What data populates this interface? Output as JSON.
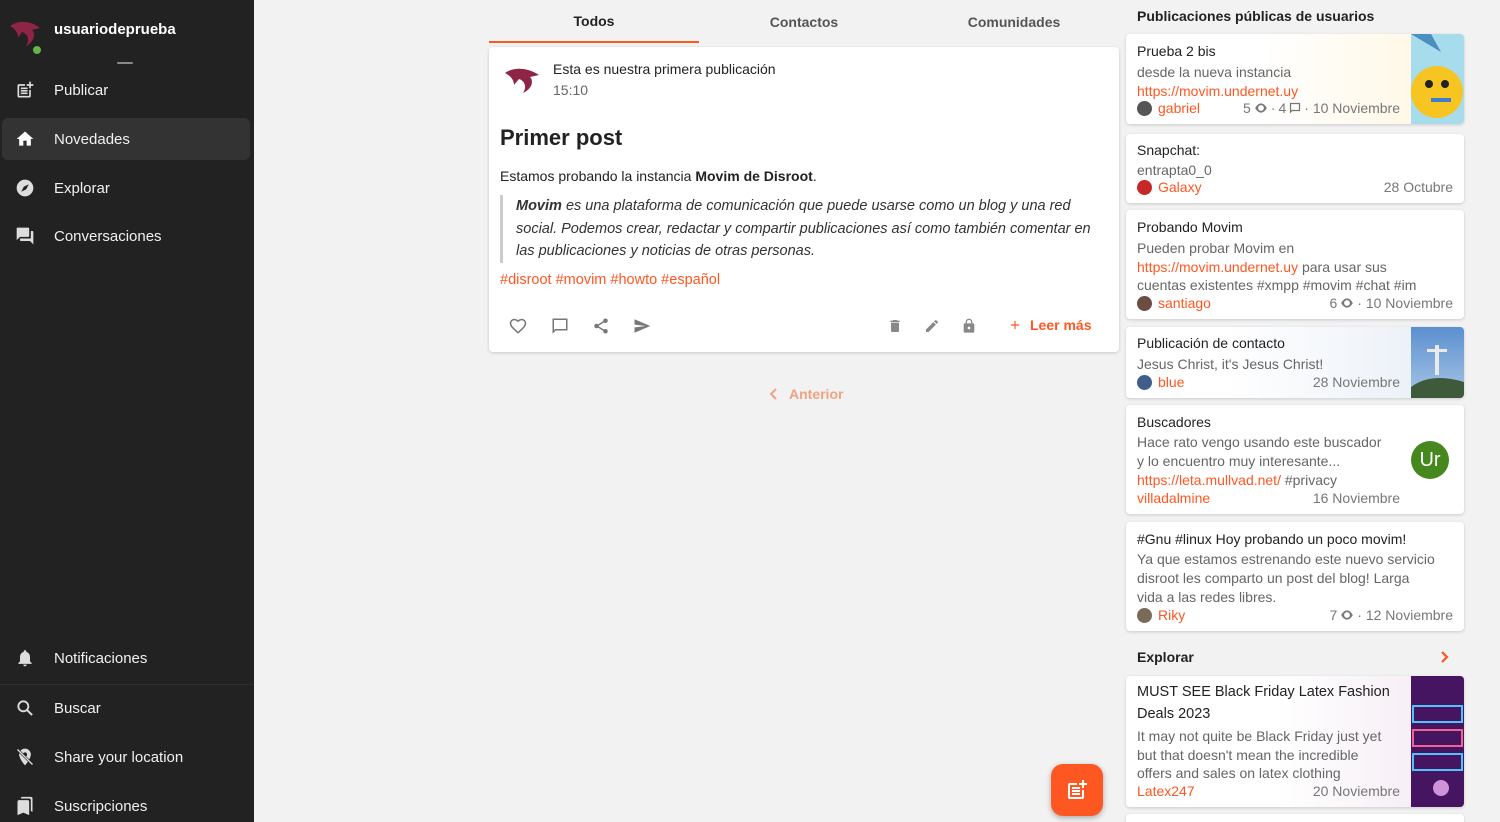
{
  "sidebar": {
    "username": "usuariodeprueba",
    "nav_top": [
      {
        "label": "Publicar",
        "icon": "post-add-icon"
      },
      {
        "label": "Novedades",
        "icon": "home-icon"
      },
      {
        "label": "Explorar",
        "icon": "compass-icon"
      },
      {
        "label": "Conversaciones",
        "icon": "chat-icon"
      }
    ],
    "nav_bottom": [
      {
        "label": "Notificaciones",
        "icon": "bell-icon"
      },
      {
        "label": "Buscar",
        "icon": "search-icon"
      },
      {
        "label": "Share your location",
        "icon": "location-off-icon"
      },
      {
        "label": "Suscripciones",
        "icon": "bookmarks-icon"
      }
    ]
  },
  "tabs": [
    "Todos",
    "Contactos",
    "Comunidades"
  ],
  "post": {
    "header_title": "Esta es nuestra primera publicación",
    "time": "15:10",
    "title": "Primer post",
    "intro_text": "Estamos probando la instancia ",
    "intro_bold": "Movim de Disroot",
    "intro_end": ".",
    "quote_bold": "Movim",
    "quote_text": " es una plataforma de comunicación que puede usarse como un blog y una red social. Podemos crear, redactar y compartir publicaciones así como también comentar en las publicaciones y noticias de otras personas.",
    "tags": "#disroot #movim #howto #español",
    "read_more": "Leer más"
  },
  "pagination": {
    "previous": "Anterior"
  },
  "right": {
    "public_heading": "Publicaciones públicas de usuarios",
    "cards": [
      {
        "title": "Prueba 2 bis",
        "line1": "desde la nueva instancia",
        "link": "https://movim.undernet.uy",
        "author": "gabriel",
        "views": "5",
        "comments": "4",
        "date": "· 10 Noviembre"
      },
      {
        "title": "Snapchat:",
        "line1": "entrapta0_0",
        "author": "Galaxy",
        "date": "28 Octubre"
      },
      {
        "title": "Probando Movim",
        "line1": "Pueden probar Movim en",
        "link": "https://movim.undernet.uy",
        "link_after": " para usar sus",
        "line3": "cuentas existentes #xmpp #movim #chat #im",
        "author": "santiago",
        "views": "6",
        "date": "· 10 Noviembre"
      },
      {
        "title": "Publicación de contacto",
        "line1": "Jesus Christ, it's Jesus Christ!",
        "author": "blue",
        "date": "28 Noviembre"
      },
      {
        "title": "Buscadores",
        "line1": "Hace rato vengo usando este buscador",
        "line2": "y lo encuentro muy interesante...",
        "link": "https://leta.mullvad.net/",
        "link_after": " #privacy",
        "author": "villadalmine",
        "date": "16 Noviembre",
        "avatar_initials": "Ur"
      },
      {
        "title": "#Gnu #linux Hoy probando un poco movim!",
        "line1": "Ya que estamos estrenando este nuevo servicio",
        "line2": "disroot les comparto un post del blog! Larga",
        "line3": "vida a las redes libres.",
        "author": "Riky",
        "views": "7",
        "date": "· 12 Noviembre"
      }
    ],
    "explore_heading": "Explorar",
    "explore_card": {
      "title_l1": "MUST SEE Black Friday Latex Fashion",
      "title_l2": "Deals 2023",
      "line1": "It may not quite be Black Friday just yet",
      "line2": "but that doesn't mean the incredible",
      "line3": "offers and sales on latex clothing",
      "author": "Latex247",
      "date": "20 Noviembre"
    }
  },
  "colors": {
    "accent": "#ff5722",
    "sidebar_bg": "#222222",
    "page_bg": "#f2f2f2"
  }
}
